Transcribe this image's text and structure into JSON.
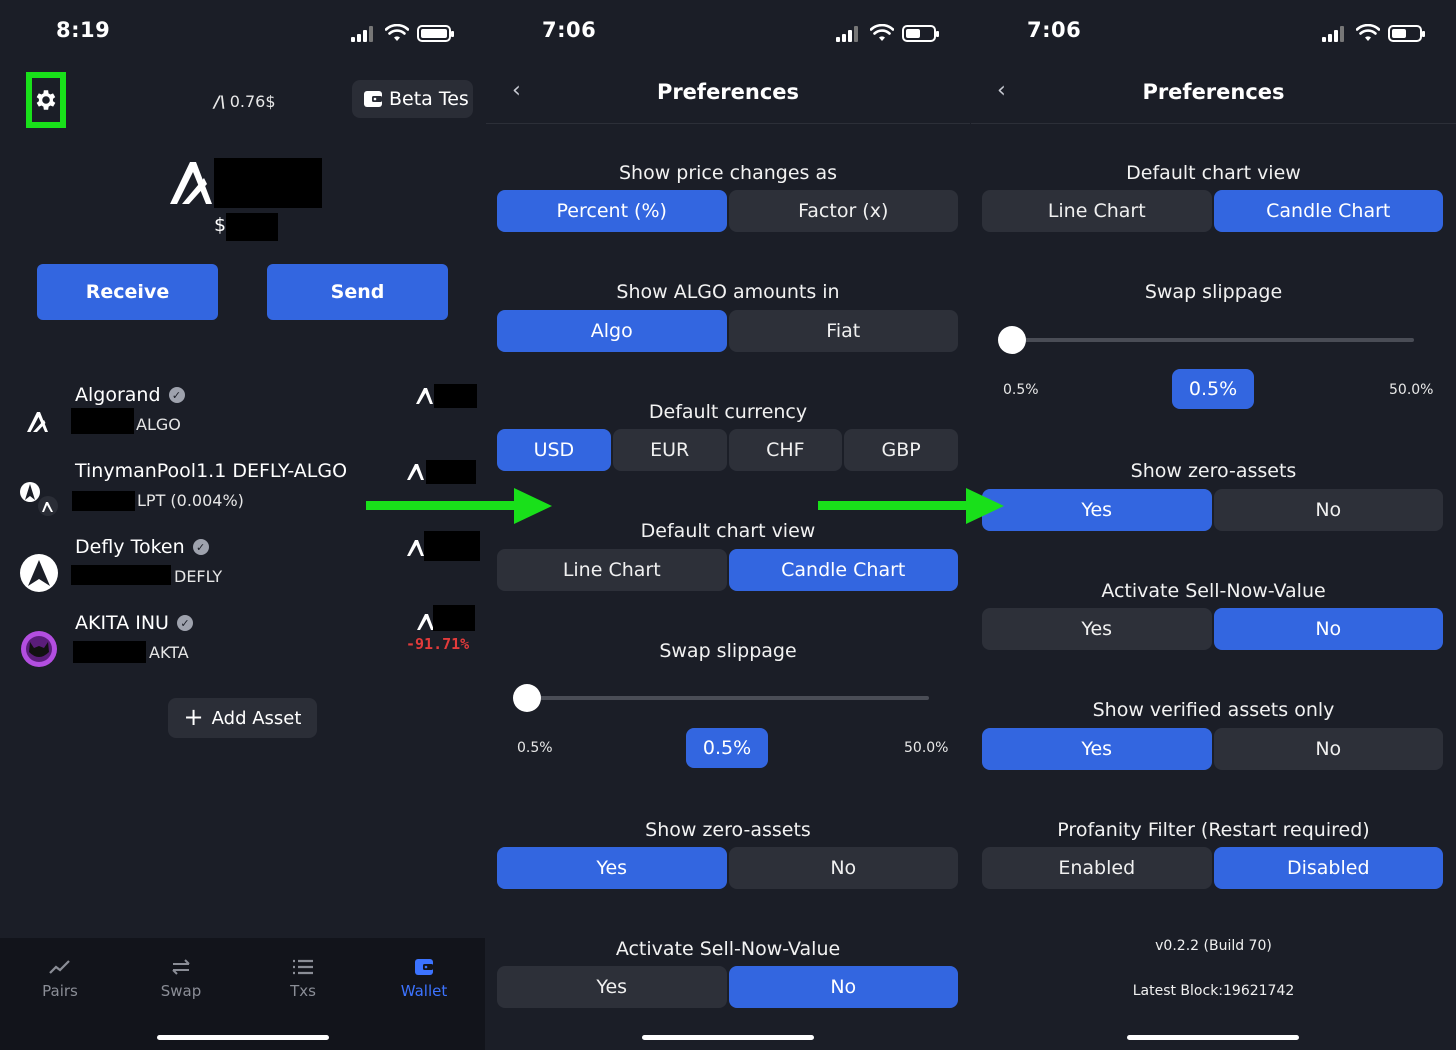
{
  "colors": {
    "accent": "#3366e0",
    "background": "#1b1e27",
    "segment_off": "#2d3039",
    "negative": "#e23b3b",
    "highlight_box": "#19e01a",
    "arrow": "#19e01a"
  },
  "wallet_screen": {
    "status_time": "8:19",
    "gear_icon": "gear-icon",
    "algo_price": "0.76$",
    "beta_button_label": "Beta Tes",
    "balance_currency_symbol": "$",
    "receive_label": "Receive",
    "send_label": "Send",
    "assets": [
      {
        "name": "Algorand",
        "unit": "ALGO",
        "verified": true,
        "change": ""
      },
      {
        "name": "TinymanPool1.1 DEFLY-ALGO",
        "unit": "LPT (0.004%)",
        "verified": false,
        "change": ""
      },
      {
        "name": "Defly Token",
        "unit": "DEFLY",
        "verified": true,
        "change": ""
      },
      {
        "name": "AKITA INU",
        "unit": "AKTA",
        "verified": true,
        "change": "-91.71%"
      }
    ],
    "add_asset_label": "Add Asset",
    "tabs": [
      {
        "label": "Pairs",
        "icon": "chart-icon",
        "active": false
      },
      {
        "label": "Swap",
        "icon": "swap-icon",
        "active": false
      },
      {
        "label": "Txs",
        "icon": "list-icon",
        "active": false
      },
      {
        "label": "Wallet",
        "icon": "wallet-icon",
        "active": true
      }
    ]
  },
  "prefs_screen_1": {
    "status_time": "7:06",
    "back_icon": "chevron-left-icon",
    "title": "Preferences",
    "show_price_changes": {
      "label": "Show price changes as",
      "options": [
        "Percent (%)",
        "Factor (x)"
      ],
      "selected": "Percent (%)"
    },
    "show_algo_amounts": {
      "label": "Show ALGO amounts in",
      "options": [
        "Algo",
        "Fiat"
      ],
      "selected": "Algo"
    },
    "default_currency": {
      "label": "Default currency",
      "options": [
        "USD",
        "EUR",
        "CHF",
        "GBP"
      ],
      "selected": "USD"
    },
    "default_chart_view": {
      "label": "Default chart view",
      "options": [
        "Line Chart",
        "Candle Chart"
      ],
      "selected": "Candle Chart"
    },
    "swap_slippage": {
      "label": "Swap slippage",
      "min": "0.5%",
      "max": "50.0%",
      "value": "0.5%",
      "level": 0
    },
    "show_zero_assets": {
      "label": "Show zero-assets",
      "options": [
        "Yes",
        "No"
      ],
      "selected": "Yes"
    },
    "activate_sell_now": {
      "label": "Activate Sell-Now-Value",
      "options": [
        "Yes",
        "No"
      ],
      "selected": "No"
    }
  },
  "prefs_screen_2": {
    "status_time": "7:06",
    "back_icon": "chevron-left-icon",
    "title": "Preferences",
    "default_chart_view": {
      "label": "Default chart view",
      "options": [
        "Line Chart",
        "Candle Chart"
      ],
      "selected": "Candle Chart"
    },
    "swap_slippage": {
      "label": "Swap slippage",
      "min": "0.5%",
      "max": "50.0%",
      "value": "0.5%",
      "level": 0
    },
    "show_zero_assets": {
      "label": "Show zero-assets",
      "options": [
        "Yes",
        "No"
      ],
      "selected": "Yes"
    },
    "activate_sell_now": {
      "label": "Activate Sell-Now-Value",
      "options": [
        "Yes",
        "No"
      ],
      "selected": "No"
    },
    "show_verified_only": {
      "label": "Show verified assets only",
      "options": [
        "Yes",
        "No"
      ],
      "selected": "Yes"
    },
    "profanity_filter": {
      "label": "Profanity Filter (Restart required)",
      "options": [
        "Enabled",
        "Disabled"
      ],
      "selected": "Disabled"
    },
    "version": "v0.2.2 (Build 70)",
    "latest_block": "Latest Block:19621742"
  }
}
